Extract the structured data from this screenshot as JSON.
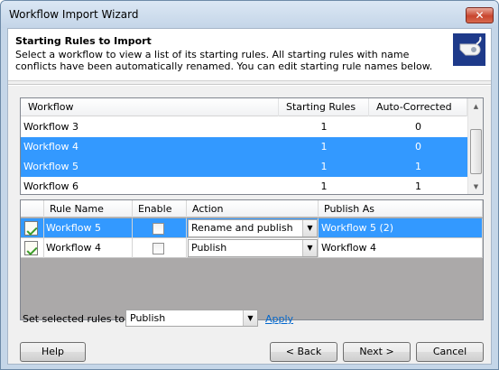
{
  "window": {
    "title": "Workflow Import Wizard",
    "close_label": "✕"
  },
  "header": {
    "title": "Starting Rules to Import",
    "description": "Select a workflow to view a list of its starting rules. All starting rules with name conflicts have been automatically renamed. You can edit starting rule names below.",
    "icon": "whistle-icon"
  },
  "workflow_grid": {
    "columns": [
      "Workflow",
      "Starting Rules",
      "Auto-Corrected"
    ],
    "rows": [
      {
        "workflow": "Workflow 3",
        "starting_rules": "1",
        "auto_corrected": "0",
        "selected": false
      },
      {
        "workflow": "Workflow 4",
        "starting_rules": "1",
        "auto_corrected": "0",
        "selected": true
      },
      {
        "workflow": "Workflow 5",
        "starting_rules": "1",
        "auto_corrected": "1",
        "selected": true
      },
      {
        "workflow": "Workflow 6",
        "starting_rules": "1",
        "auto_corrected": "1",
        "selected": false
      }
    ]
  },
  "rules_grid": {
    "columns": [
      "Rule Name",
      "Enable",
      "Action",
      "Publish As"
    ],
    "rows": [
      {
        "rule_name": "Workflow 5",
        "enabled": false,
        "action": "Rename and publish",
        "publish_as": "Workflow 5 (2)",
        "selected": true
      },
      {
        "rule_name": "Workflow 4",
        "enabled": false,
        "action": "Publish",
        "publish_as": "Workflow 4",
        "selected": false
      }
    ]
  },
  "bulk": {
    "label": "Set selected rules to:",
    "value": "Publish",
    "apply_label": "Apply"
  },
  "buttons": {
    "help": "Help",
    "back": "< Back",
    "next": "Next >",
    "cancel": "Cancel"
  },
  "colors": {
    "selection": "#3399ff",
    "link": "#0066cc",
    "close": "#c8452f"
  }
}
